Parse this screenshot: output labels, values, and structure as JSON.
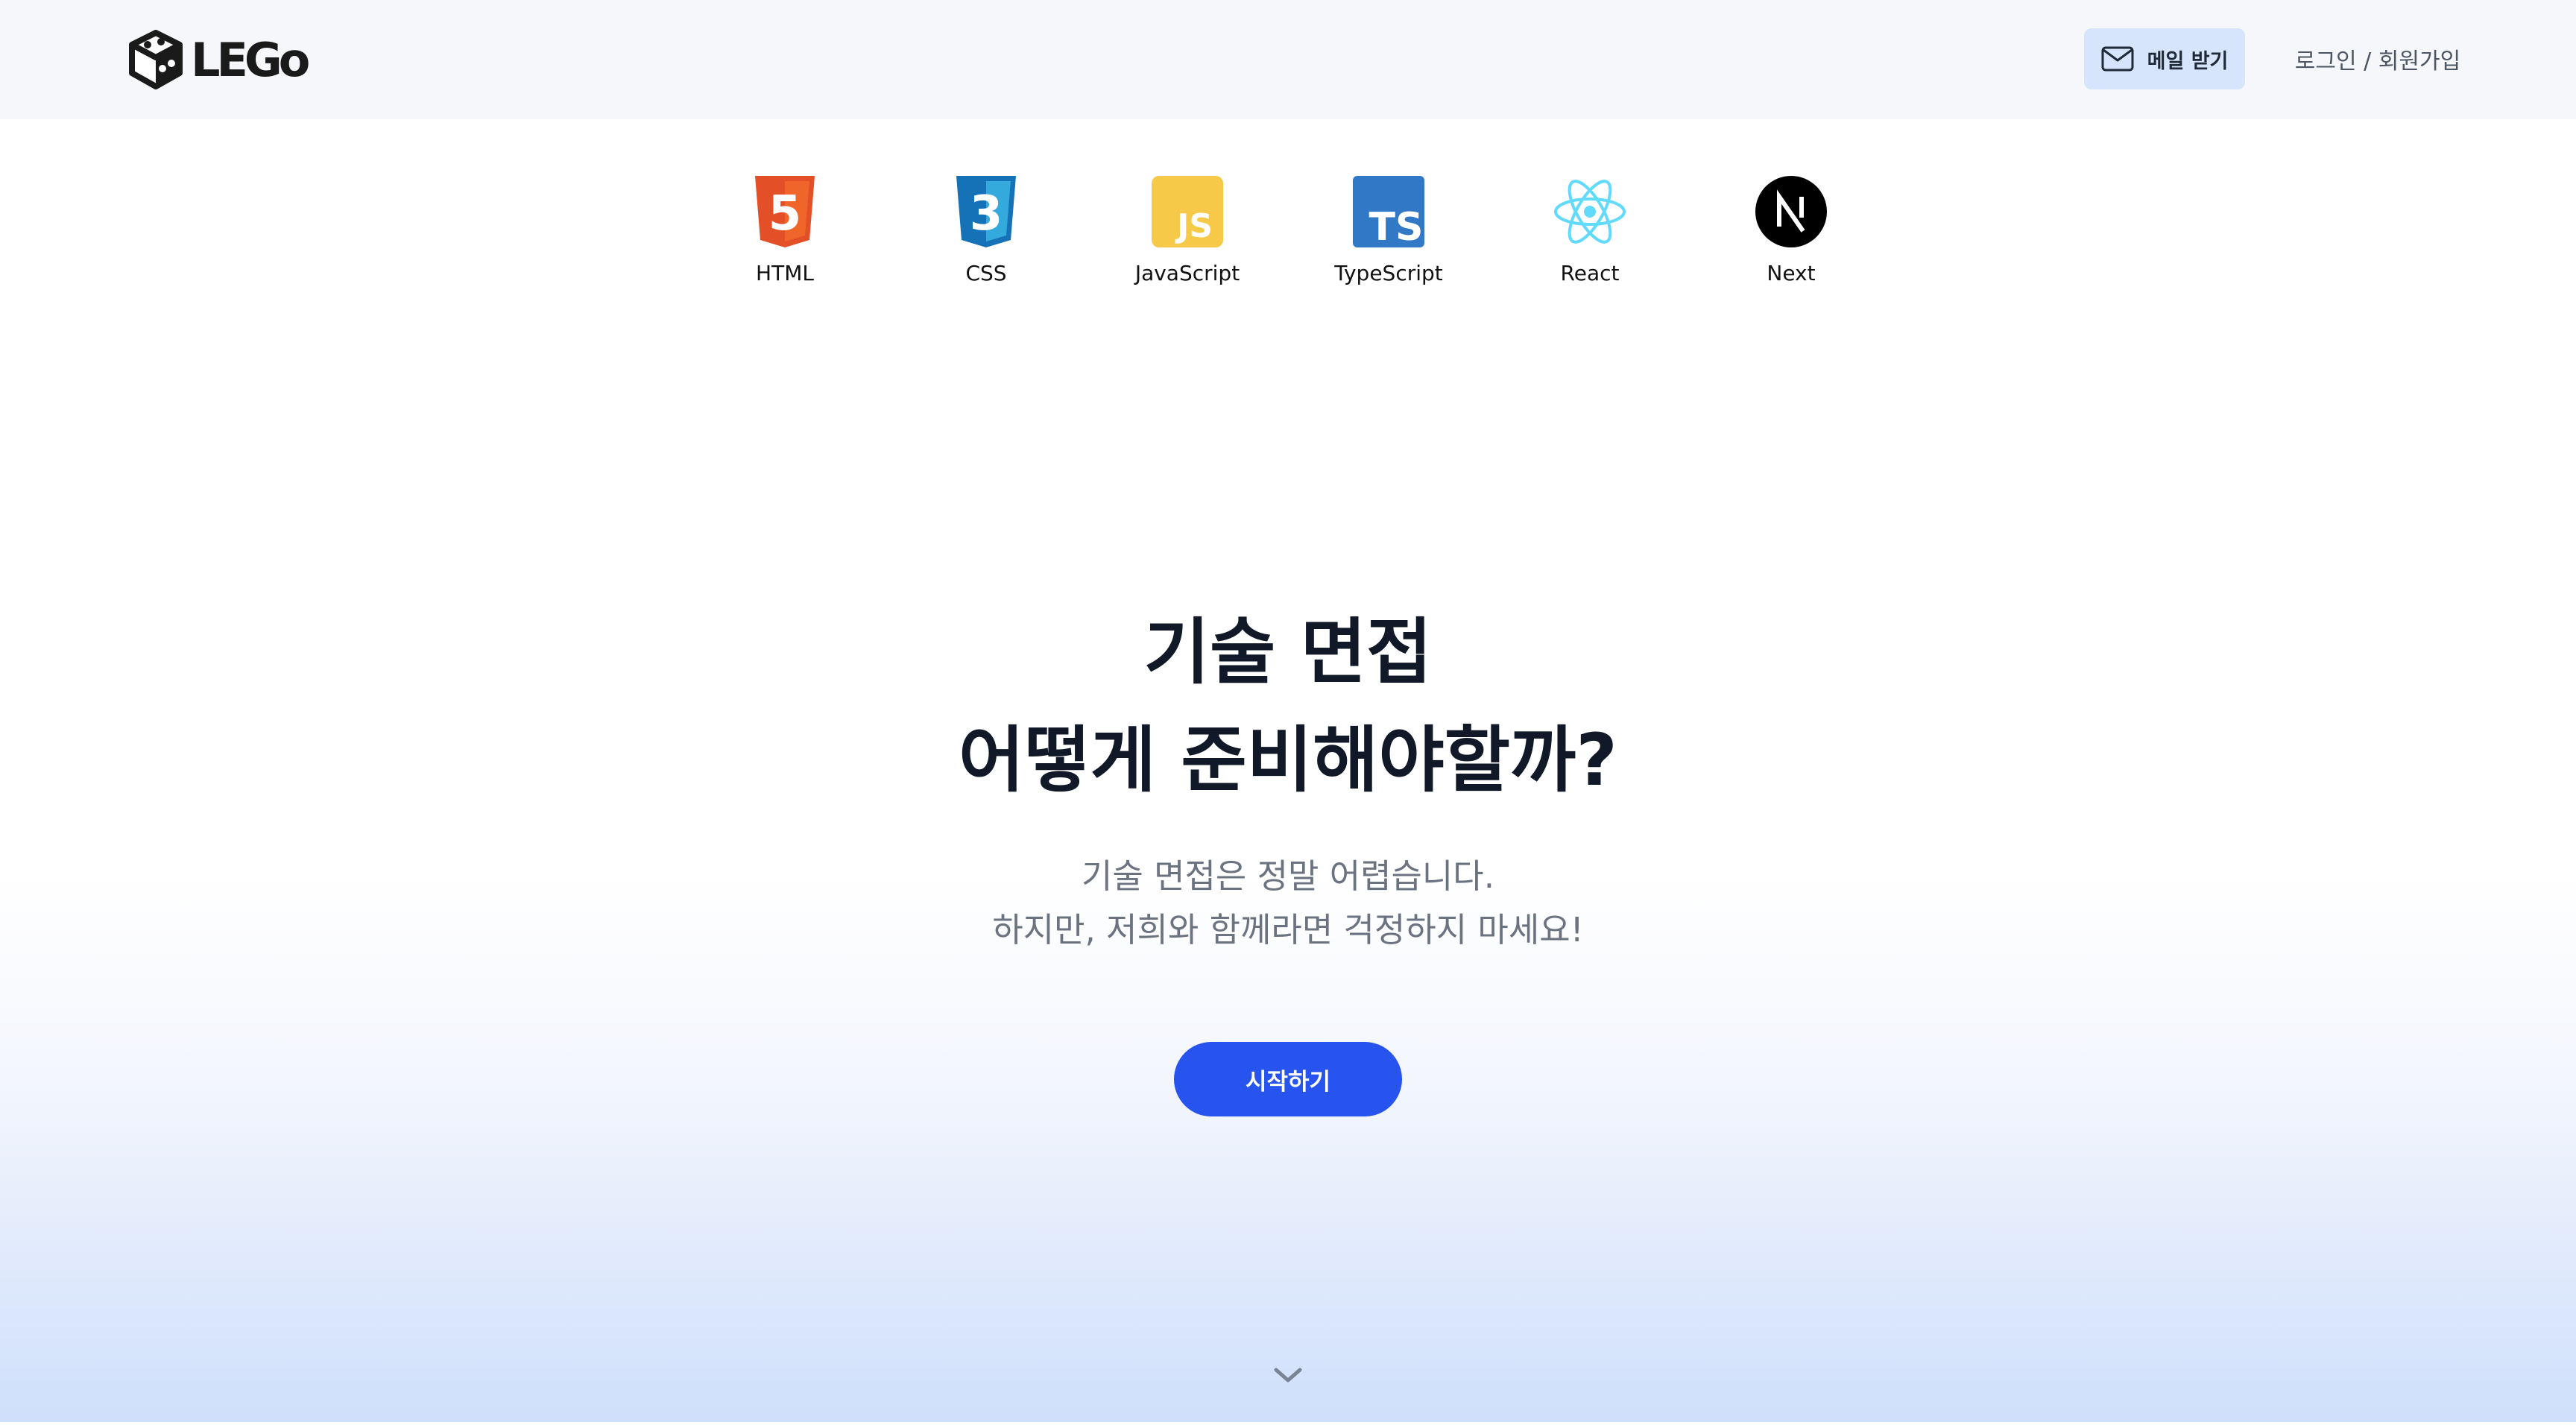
{
  "header": {
    "logo_text": "LEGo",
    "mail_button_label": "메일 받기",
    "login_link_label": "로그인 / 회원가입"
  },
  "tech_stack": [
    {
      "label": "HTML",
      "icon": "html5-icon",
      "color": "#e34f26"
    },
    {
      "label": "CSS",
      "icon": "css3-icon",
      "color": "#1572b6"
    },
    {
      "label": "JavaScript",
      "icon": "javascript-icon",
      "color": "#f7c948"
    },
    {
      "label": "TypeScript",
      "icon": "typescript-icon",
      "color": "#3178c6"
    },
    {
      "label": "React",
      "icon": "react-icon",
      "color": "#61dafb"
    },
    {
      "label": "Next",
      "icon": "nextjs-icon",
      "color": "#000000"
    }
  ],
  "hero": {
    "title_line1": "기술 면접",
    "title_line2": "어떻게 준비해야할까?",
    "subtitle_line1": "기술 면접은 정말 어렵습니다.",
    "subtitle_line2": "하지만, 저희와 함께라면 걱정하지 마세요!",
    "start_button_label": "시작하기"
  },
  "colors": {
    "accent": "#2753ef",
    "mail_button_bg": "#d6e4fc",
    "header_bg": "#f5f7fa"
  }
}
